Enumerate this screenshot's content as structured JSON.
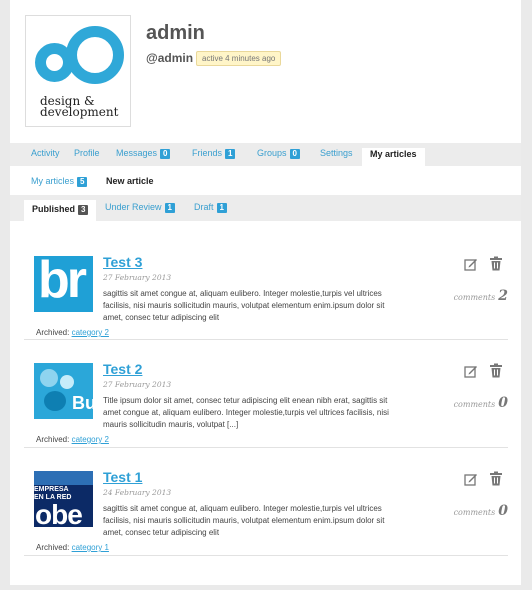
{
  "profile": {
    "name": "admin",
    "handle": "@admin",
    "activity": "active 4 minutes ago",
    "logo_text_line1": "design &",
    "logo_text_line2": "development"
  },
  "tabs": [
    {
      "label": "Activity"
    },
    {
      "label": "Profile"
    },
    {
      "label": "Messages",
      "badge": "0"
    },
    {
      "label": "Friends",
      "badge": "1"
    },
    {
      "label": "Groups",
      "badge": "0"
    },
    {
      "label": "Settings"
    },
    {
      "label": "My articles"
    }
  ],
  "subnav": {
    "my_articles": "My articles",
    "my_articles_count": "5",
    "new_article": "New article"
  },
  "status_tabs": [
    {
      "label": "Published",
      "badge": "3"
    },
    {
      "label": "Under Review",
      "badge": "1"
    },
    {
      "label": "Draft",
      "badge": "1"
    }
  ],
  "articles": [
    {
      "title": "Test 3",
      "date": "27 February 2013",
      "body": "sagittis sit amet congue at, aliquam eulibero. Integer molestie,turpis vel ultrices facilisis, nisi mauris sollicitudin mauris, volutpat elementum enim.ipsum dolor sit amet, consec tetur adipiscing elit",
      "archived_label": "Archived:",
      "category": "category 2",
      "comments_label": "comments",
      "comments_count": "2"
    },
    {
      "title": "Test 2",
      "date": "27 February 2013",
      "body": "Title ipsum dolor sit amet, consec tetur adipiscing elit enean nibh erat, sagittis sit amet congue at, aliquam eulibero. Integer molestie,turpis vel ultrices facilisis, nisi mauris sollicitudin mauris, volutpat [...]",
      "archived_label": "Archived:",
      "category": "category 2",
      "comments_label": "comments",
      "comments_count": "0"
    },
    {
      "title": "Test 1",
      "date": "24 February 2013",
      "body": "sagittis sit amet congue at, aliquam eulibero. Integer molestie,turpis vel ultrices facilisis, nisi mauris sollicitudin mauris, volutpat elementum enim.ipsum dolor sit amet, consec tetur adipiscing elit",
      "archived_label": "Archived:",
      "category": "category 1",
      "comments_label": "comments",
      "comments_count": "0"
    }
  ],
  "thumb_text": {
    "article1": "br",
    "article2": "Bu",
    "article3_line1": "EMPRESA",
    "article3_line2": "EN LA RED",
    "article3_big": "obe"
  },
  "colors": {
    "accent": "#2fa0d6",
    "badge_dark": "#555555",
    "background": "#eaeaea"
  }
}
